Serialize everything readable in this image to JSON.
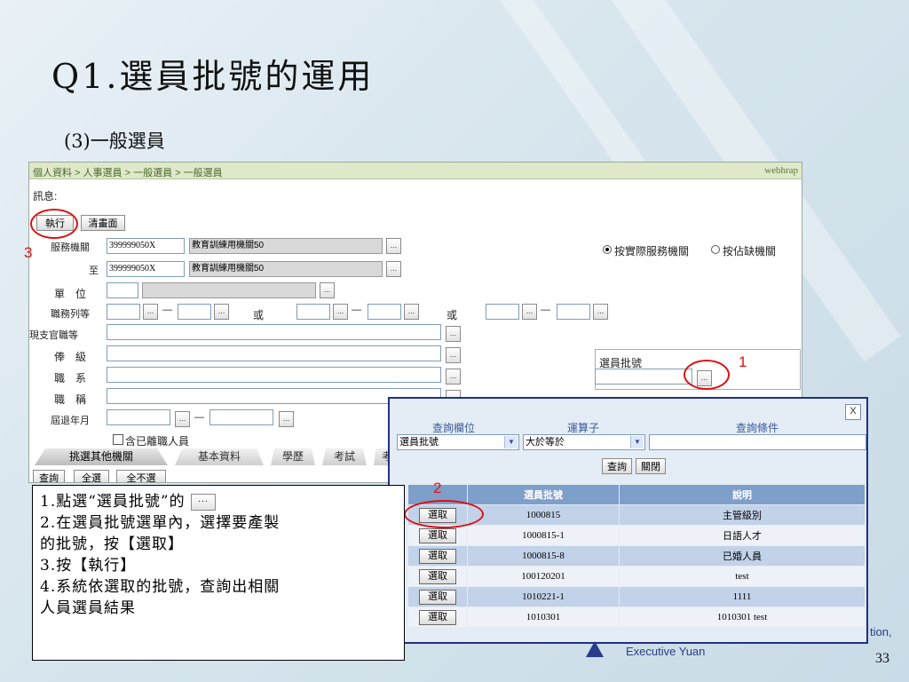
{
  "slide": {
    "title": "Q1.選員批號的運用",
    "subtitle": "(3)一般選員",
    "page_number": "33",
    "logo_text": "Executive Yuan",
    "edge_text": "tion,"
  },
  "form": {
    "breadcrumb": "個人資料 > 人事選員 > 一般選員 > 一般選員",
    "brand": "webhrap",
    "message_label": "訊息:",
    "execute_button": "執行",
    "clear_button": "清畫面",
    "service_org_label": "服務機關",
    "service_org_code": "399999050X",
    "service_org_name": "教育訓練用機關50",
    "to_label": "至",
    "to_org_code": "399999050X",
    "to_org_name": "教育訓練用機關50",
    "unit_label": "單　位",
    "rank_label": "職務列等",
    "dash": "—",
    "or_label": "或",
    "current_rank_label": "現支官職等",
    "salary_label": "俸　級",
    "series_label": "職　系",
    "title_label": "職　稱",
    "retire_label": "屆退年月",
    "include_resigned": "含已離職人員",
    "radio_actual": "按實際服務機關",
    "radio_vacancy": "按佔缺機關",
    "batch_label": "選員批號",
    "query_button": "查詢",
    "select_all_button": "全選",
    "select_none_button": "全不選",
    "dots": "...",
    "tabs": [
      "挑選其他機關",
      "基本資料",
      "學歷",
      "考試",
      "考"
    ]
  },
  "popup": {
    "close": "X",
    "col_field": "查詢欄位",
    "col_operator": "運算子",
    "col_condition": "查詢條件",
    "field_value": "選員批號",
    "operator_value": "大於等於",
    "condition_value": "",
    "query_button": "查詢",
    "close_button": "關閉",
    "table_headers": [
      "",
      "選員批號",
      "說明"
    ],
    "pick_label": "選取",
    "rows": [
      {
        "id": "1000815",
        "desc": "主管級別"
      },
      {
        "id": "1000815-1",
        "desc": "日語人才"
      },
      {
        "id": "1000815-8",
        "desc": "已婚人員"
      },
      {
        "id": "100120201",
        "desc": "test"
      },
      {
        "id": "1010221-1",
        "desc": "1111"
      },
      {
        "id": "1010301",
        "desc": "1010301 test"
      }
    ]
  },
  "annotations": {
    "marker_1": "1",
    "marker_2": "2",
    "marker_3": "3",
    "accent_color": "#dd1111"
  },
  "note": {
    "line1_prefix": "1.點選“選員批號”的",
    "line2": "2.在選員批號選單內，選擇要產製",
    "line3": "的批號，按【選取】",
    "line4": "3.按【執行】",
    "line5": "4.系統依選取的批號，查詢出相關",
    "line6": "人員選員結果"
  }
}
